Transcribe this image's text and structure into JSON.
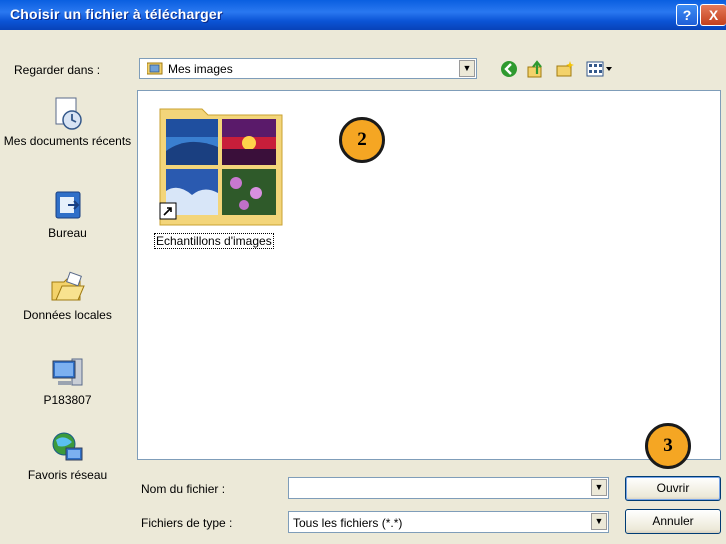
{
  "window": {
    "title": "Choisir un fichier à télécharger",
    "help_label": "?",
    "close_label": "X"
  },
  "toolbar": {
    "lookin_label": "Regarder dans :",
    "lookin_value": "Mes images",
    "icons": [
      "back-icon",
      "up-folder-icon",
      "new-folder-icon",
      "view-menu-icon"
    ]
  },
  "places": [
    {
      "label": "Mes documents récents",
      "icon": "recent-documents-icon"
    },
    {
      "label": "Bureau",
      "icon": "desktop-icon"
    },
    {
      "label": "Données locales",
      "icon": "local-data-icon"
    },
    {
      "label": "P183807",
      "icon": "computer-icon"
    },
    {
      "label": "Favoris réseau",
      "icon": "network-places-icon"
    }
  ],
  "files": [
    {
      "label": "Echantillons d'images",
      "icon": "sample-pictures-folder-icon"
    }
  ],
  "callouts": {
    "two": "2",
    "three": "3"
  },
  "filename": {
    "label": "Nom du fichier :",
    "value": ""
  },
  "filetype": {
    "label": "Fichiers de type :",
    "value": "Tous les fichiers (*.*)"
  },
  "buttons": {
    "open": "Ouvrir",
    "cancel": "Annuler"
  }
}
